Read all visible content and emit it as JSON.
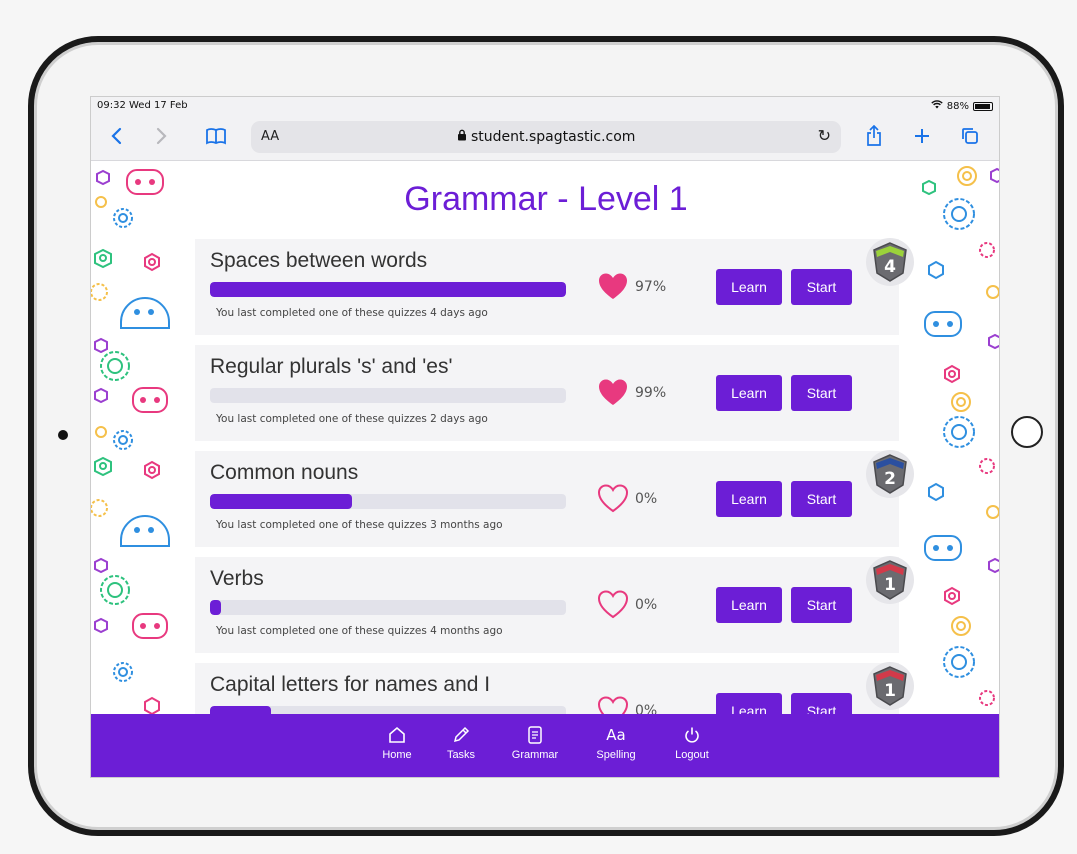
{
  "status_bar": {
    "time": "09:32 Wed 17 Feb",
    "battery": "88%"
  },
  "browser": {
    "text_size": "AA",
    "url": "student.spagtastic.com"
  },
  "page_title": "Grammar - Level 1",
  "colors": {
    "accent": "#6c1ed6",
    "heart": "#e8397f"
  },
  "topics": [
    {
      "title": "Spaces between words",
      "progress": 1.0,
      "score": "97%",
      "heart_filled": true,
      "note": "You last completed one of these quizzes 4 days ago",
      "learn": "Learn",
      "start": "Start",
      "badge": "4"
    },
    {
      "title": "Regular plurals 's' and 'es'",
      "progress": 0.0,
      "score": "99%",
      "heart_filled": true,
      "note": "You last completed one of these quizzes 2 days ago",
      "learn": "Learn",
      "start": "Start",
      "badge": ""
    },
    {
      "title": "Common nouns",
      "progress": 0.4,
      "score": "0%",
      "heart_filled": false,
      "note": "You last completed one of these quizzes 3 months ago",
      "learn": "Learn",
      "start": "Start",
      "badge": "2"
    },
    {
      "title": "Verbs",
      "progress": 0.03,
      "score": "0%",
      "heart_filled": false,
      "note": "You last completed one of these quizzes 4 months ago",
      "learn": "Learn",
      "start": "Start",
      "badge": "1"
    },
    {
      "title": "Capital letters for names and I",
      "progress": 0.17,
      "score": "0%",
      "heart_filled": false,
      "note": "",
      "learn": "Learn",
      "start": "Start",
      "badge": "1"
    }
  ],
  "nav": [
    {
      "label": "Home",
      "icon": "home-icon"
    },
    {
      "label": "Tasks",
      "icon": "pencil-icon"
    },
    {
      "label": "Grammar",
      "icon": "document-icon"
    },
    {
      "label": "Spelling",
      "icon": "text-aa-icon",
      "glyph": "Aa"
    },
    {
      "label": "Logout",
      "icon": "power-icon"
    }
  ]
}
